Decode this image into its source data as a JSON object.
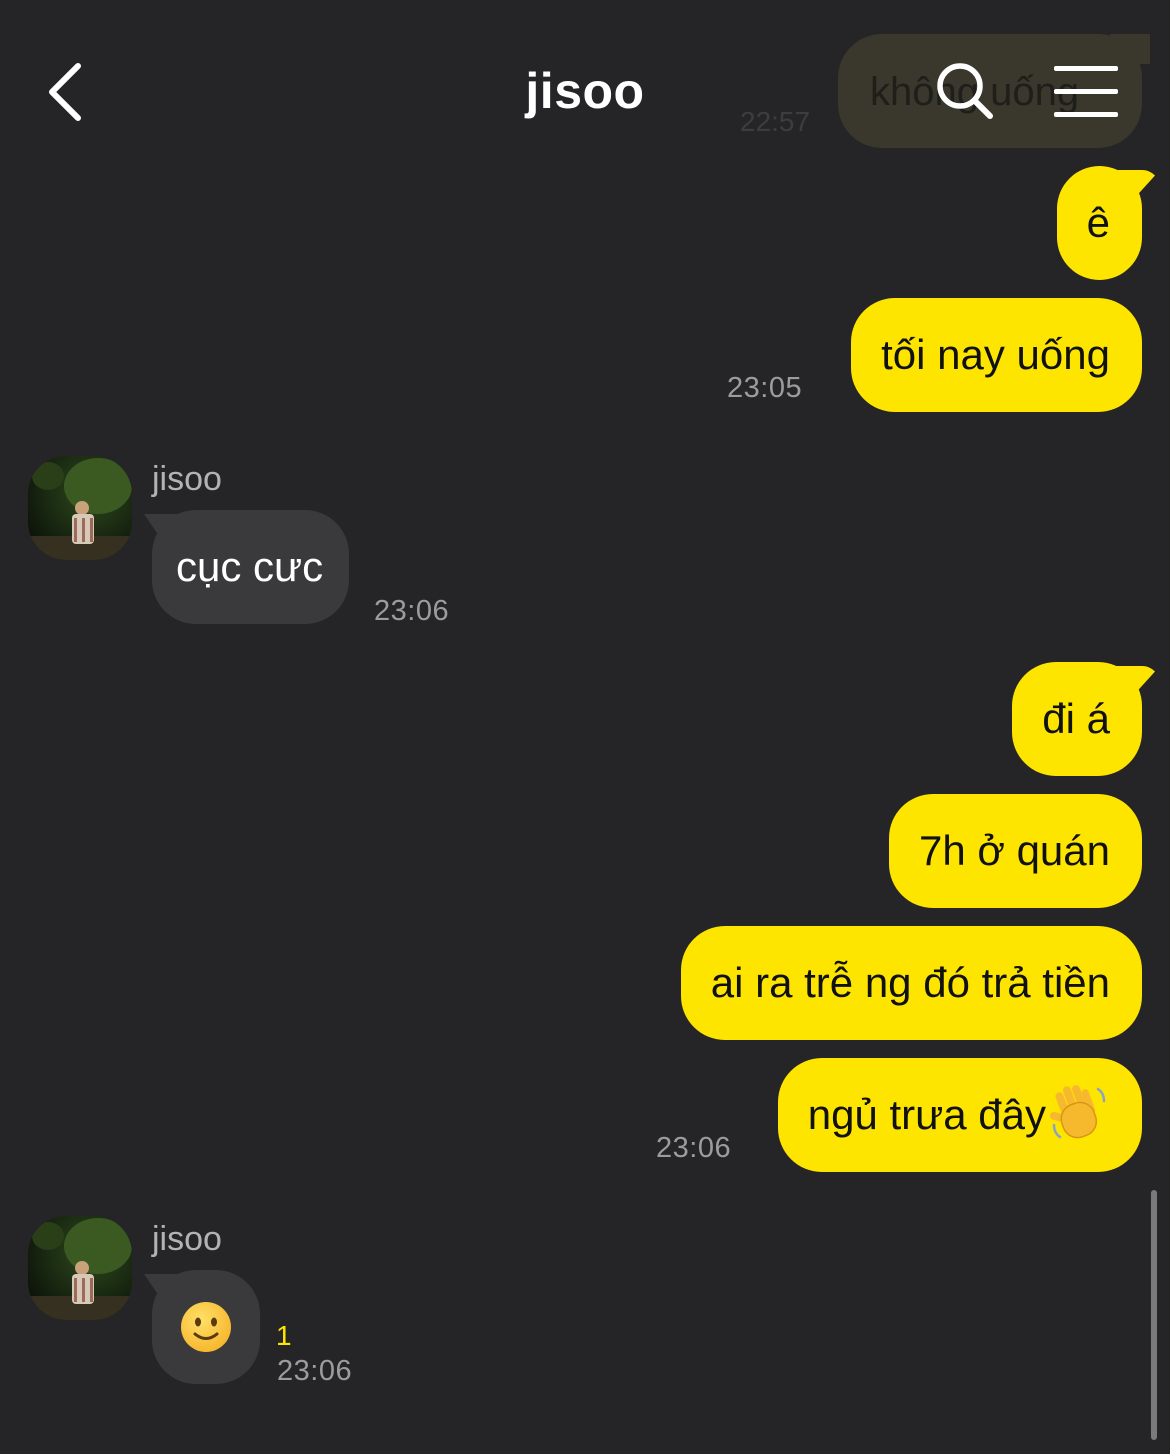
{
  "header": {
    "title": "jisoo",
    "back_icon": "chevron-left-icon",
    "search_icon": "search-icon",
    "menu_icon": "hamburger-menu-icon"
  },
  "colors": {
    "background": "#252527",
    "sent_bubble": "#fee500",
    "received_bubble": "#3a3a3c",
    "timestamp": "#9c9c9c",
    "unread_count": "#fee500"
  },
  "previous_message": {
    "text": "không uống",
    "time": "22:57"
  },
  "messages": {
    "m1": {
      "text": "ê"
    },
    "m2": {
      "text": "tối nay uống",
      "time": "23:05"
    },
    "m3": {
      "sender": "jisoo",
      "text": "cục cưc",
      "time": "23:06"
    },
    "m4": {
      "text": "đi á"
    },
    "m5": {
      "text": "7h ở quán"
    },
    "m6": {
      "text": "ai ra trễ ng đó trả tiền"
    },
    "m7": {
      "text": "ngủ trưa đây",
      "emoji": "waving-hand-emoji",
      "time": "23:06"
    },
    "m8": {
      "sender": "jisoo",
      "emoji": "slightly-smiling-face-emoji",
      "unread": "1",
      "time": "23:06"
    }
  }
}
